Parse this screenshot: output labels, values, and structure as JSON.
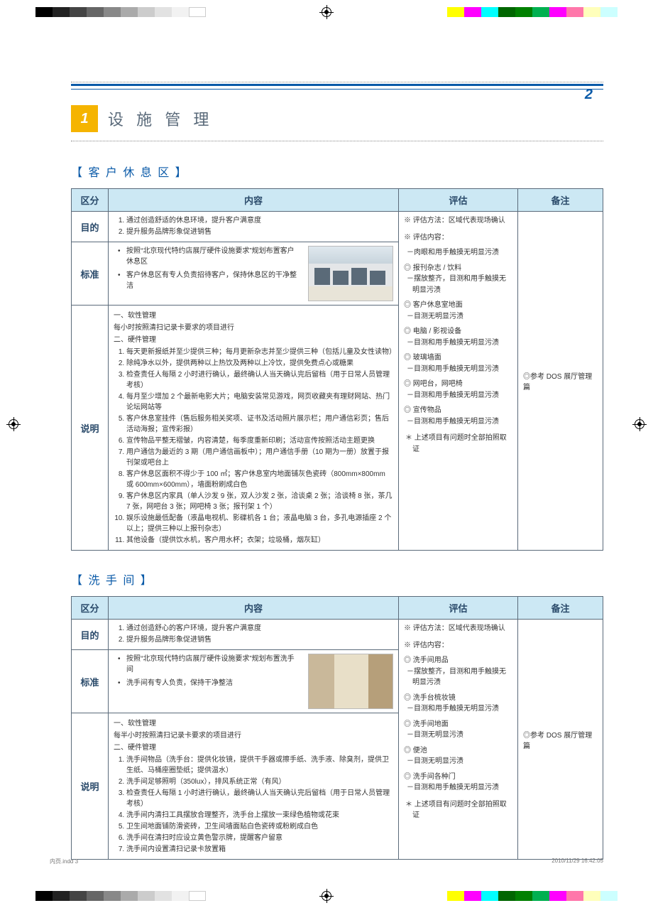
{
  "page_number_top": "2",
  "chapter": {
    "number": "1",
    "title": "设 施 管 理"
  },
  "sections": [
    {
      "title": "【 客 户 休 息 区 】",
      "headers": [
        "区分",
        "内容",
        "评估",
        "备注"
      ],
      "rows": {
        "purpose": {
          "label": "目的",
          "items": [
            "通过创造舒适的休息环境，提升客户满意度",
            "提升服务品牌形象促进销售"
          ]
        },
        "standard": {
          "label": "标准",
          "items": [
            "按照“北京现代特约店展厅硬件设施要求”规划布置客户休息区",
            "客户休息区有专人负责招待客户，保持休息区的干净整洁"
          ]
        },
        "explain": {
          "label": "说明",
          "soft_h": "一、软性管理",
          "soft_line": "每小时按照清扫记录卡要求的项目进行",
          "hard_h": "二、硬件管理",
          "items": [
            "每天更新报纸并至少提供三种；每月更新杂志并至少提供三种（包括儿童及女性读物）",
            "除纯净水以外，提供两种以上热饮及两种以上冷饮，提供免费点心或糖果",
            "检查责任人每隔 2 小时进行确认，最终确认人当天确认完后留档（用于日常人员管理考核）",
            "每月至少增加 2 个最新电影大片；电脑安装常见游戏，网页收藏夹有理财网站、热门论坛网站等",
            "客户休息室挂件（售后服务相关奖项、证书及活动照片展示栏；用户通信彩页；售后活动海报；宣传彩报）",
            "宣传物品平整无褶皱，内容清楚，每季度重新印刷；活动宣传按照活动主题更换",
            "用户通信为最近的 3 期（用户通信画板中）；用户通信手册（10 期为一册）放置于报刊架或吧台上",
            "客户休息区面积不得少于 100 ㎡；客户休息室内地面铺灰色瓷砖（800mm×800mm 或 600mm×600mm），墙面粉刷成白色",
            "客户休息区内家具（单人沙发 9 张，双人沙发 2 张，洽谈桌 2 张；洽谈椅 8 张，茶几 7 张，网吧台 3 张；网吧椅 3 张；报刊架 1 个）",
            "娱乐设施最低配备（液晶电视机、影碟机各 1 台；液晶电脑 3 台，多孔电源插座 2 个以上；提供三种以上报刊杂志）",
            "其他设备（提供饮水机，客户用水杯；衣架；垃圾桶，烟灰缸）"
          ]
        },
        "eval": {
          "method": "※ 评估方法：区域代表现场确认",
          "content_h": "※ 评估内容：",
          "first_dash": "肉眼和用手触摸无明显污渍",
          "groups": [
            {
              "t": "报刊杂志 / 饮料",
              "d": "摆放整齐，目测和用手触摸无明显污渍"
            },
            {
              "t": "客户休息室地面",
              "d": "目测无明显污渍"
            },
            {
              "t": "电脑 / 影视设备",
              "d": "目测和用手触摸无明显污渍"
            },
            {
              "t": "玻璃墙面",
              "d": "目测和用手触摸无明显污渍"
            },
            {
              "t": "网吧台，网吧椅",
              "d": "目测和用手触摸无明显污渍"
            },
            {
              "t": "宣传物品",
              "d": "目测和用手触摸无明显污渍"
            }
          ],
          "star": "上述项目有问题时全部拍照取证"
        },
        "note": "◎参考 DOS 展厅管理篇"
      }
    },
    {
      "title": "【 洗 手 间 】",
      "headers": [
        "区分",
        "内容",
        "评估",
        "备注"
      ],
      "rows": {
        "purpose": {
          "label": "目的",
          "items": [
            "通过创造舒心的客户环境，提升客户满意度",
            "提升服务品牌形象促进销售"
          ]
        },
        "standard": {
          "label": "标准",
          "items": [
            "按照“北京现代特约店展厅硬件设施要求”规划布置洗手间",
            "洗手间有专人负责，保持干净整洁"
          ]
        },
        "explain": {
          "label": "说明",
          "soft_h": "一、软性管理",
          "soft_line": "每半小时按照清扫记录卡要求的项目进行",
          "hard_h": "二、硬件管理",
          "items": [
            "洗手间物品（洗手台：提供化妆镜，提供干手器或擦手纸、洗手液、除臭剂，提供卫生纸、马桶座圈垫纸；提供温水）",
            "洗手间足够照明（350lux），排风系统正常（有风）",
            "检查责任人每隔 1 小时进行确认，最终确认人当天确认完后留档（用于日常人员管理考核）",
            "洗手间内清扫工具摆放合理整齐，洗手台上摆放一束绿色植物或花束",
            "卫生间地面铺防滑瓷砖，卫生间墙面贴白色瓷砖或粉刷成白色",
            "洗手间在清扫时应设立黄色警示牌，提醒客户留意",
            "洗手间内设置清扫记录卡放置箱"
          ]
        },
        "eval": {
          "method": "※ 评估方法：区域代表现场确认",
          "content_h": "※ 评估内容：",
          "groups": [
            {
              "t": "洗手间用品",
              "d": "摆放整齐，目测和用手触摸无明显污渍"
            },
            {
              "t": "洗手台梳妆镜",
              "d": "目测和用手触摸无明显污渍"
            },
            {
              "t": "洗手间地面",
              "d": "目测无明显污渍"
            },
            {
              "t": "便池",
              "d": "目测无明显污渍"
            },
            {
              "t": "洗手间各种门",
              "d": "目测和用手触摸无明显污渍"
            }
          ],
          "star": "上述项目有问题时全部拍照取证"
        },
        "note": "◎参考 DOS 展厅管理篇"
      }
    }
  ],
  "footer": {
    "file": "内页.indd   3",
    "timestamp": "2010/11/29   16:42:05"
  }
}
